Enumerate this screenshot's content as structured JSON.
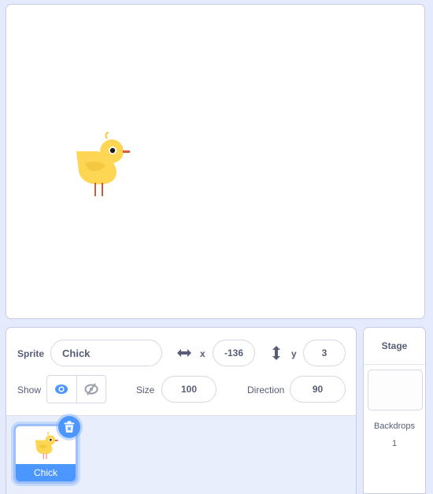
{
  "stage": {
    "sprite_name": "Chick"
  },
  "sprite_info": {
    "sprite_label": "Sprite",
    "sprite_name": "Chick",
    "x_label": "x",
    "x_value": "-136",
    "y_label": "y",
    "y_value": "3",
    "show_label": "Show",
    "size_label": "Size",
    "size_value": "100",
    "direction_label": "Direction",
    "direction_value": "90",
    "visible": true
  },
  "sprite_list": {
    "items": [
      {
        "name": "Chick",
        "selected": true
      }
    ]
  },
  "stage_panel": {
    "title": "Stage",
    "backdrops_label": "Backdrops",
    "backdrops_count": "1"
  },
  "colors": {
    "accent": "#4c97ff",
    "background": "#e5ebfc",
    "text": "#575e75"
  }
}
